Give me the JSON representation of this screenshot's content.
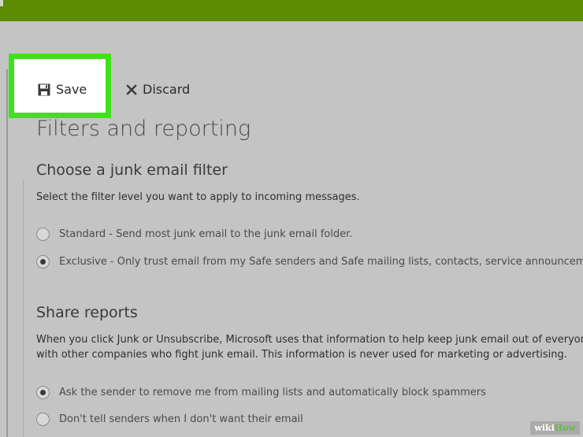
{
  "toolbar": {
    "save_label": "Save",
    "save_icon": "save-disk-icon",
    "discard_label": "Discard",
    "discard_icon": "close-x-icon"
  },
  "page": {
    "title": "Filters and reporting"
  },
  "junk_filter": {
    "heading": "Choose a junk email filter",
    "description": "Select the filter level you want to apply to incoming messages.",
    "options": [
      {
        "label": "Standard - Send most junk email to the junk email folder.",
        "selected": false
      },
      {
        "label": "Exclusive - Only trust email from my Safe senders and Safe mailing lists, contacts, service announcements,",
        "selected": true
      }
    ]
  },
  "share_reports": {
    "heading": "Share reports",
    "description_line1": "When you click Junk or Unsubscribe, Microsoft uses that information to help keep junk email out of everyon",
    "description_line2": "with other companies who fight junk email. This information is never used for marketing or advertising.",
    "options": [
      {
        "label": "Ask the sender to remove me from mailing lists and automatically block spammers",
        "selected": true
      },
      {
        "label": "Don't tell senders when I don't want their email",
        "selected": false
      }
    ]
  },
  "watermark": {
    "wiki": "wiki",
    "how": "How"
  },
  "colors": {
    "topbar": "#5c8c00",
    "highlight_border": "#3fe21a",
    "background": "#c4c4c4"
  }
}
